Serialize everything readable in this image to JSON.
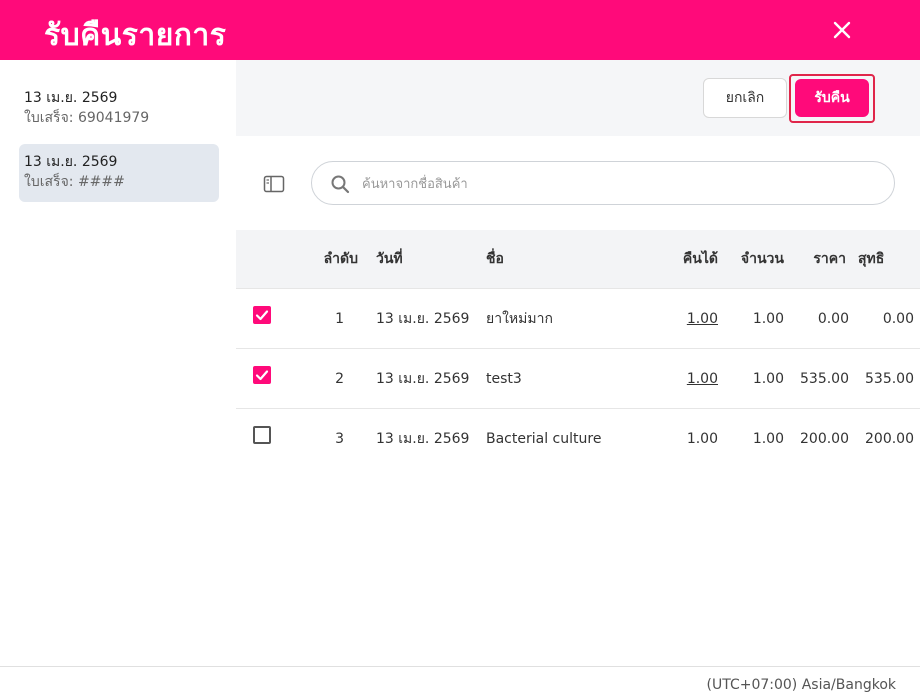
{
  "header": {
    "title": "รับคืนรายการ",
    "close_icon": "close-icon",
    "bg_color": "#ff0a7a"
  },
  "receipts": [
    {
      "date": "13 เม.ย. 2569",
      "receipt_no": "ใบเสร็จ: 69041979",
      "active": false
    },
    {
      "date": "13 เม.ย. 2569",
      "receipt_no": "ใบเสร็จ: ####",
      "active": true
    }
  ],
  "toolbar": {
    "cancel_label": "ยกเลิก",
    "accept_label": "รับคืน"
  },
  "search": {
    "placeholder": "ค้นหาจากชื่อสินค้า",
    "value": ""
  },
  "table": {
    "columns": [
      "ลำดับ",
      "วันที่",
      "ชื่อ",
      "คืนได้",
      "จำนวน",
      "ราคา",
      "สุทธิ"
    ],
    "rows": [
      {
        "checked": true,
        "index": "1",
        "date": "13 เม.ย. 2569",
        "name": "ยาใหม่มาก",
        "returnable": "1.00",
        "returnable_link": true,
        "qty": "1.00",
        "price": "0.00",
        "net": "0.00"
      },
      {
        "checked": true,
        "index": "2",
        "date": "13 เม.ย. 2569",
        "name": "test3",
        "returnable": "1.00",
        "returnable_link": true,
        "qty": "1.00",
        "price": "535.00",
        "net": "535.00"
      },
      {
        "checked": false,
        "index": "3",
        "date": "13 เม.ย. 2569",
        "name": "Bacterial culture",
        "returnable": "1.00",
        "returnable_link": false,
        "qty": "1.00",
        "price": "200.00",
        "net": "200.00"
      }
    ]
  },
  "footer": {
    "timezone": "(UTC+07:00) Asia/Bangkok"
  },
  "colors": {
    "accent": "#ff0a7a",
    "highlight_border": "#e0264a",
    "selected_receipt_bg": "#e3e8ef"
  }
}
